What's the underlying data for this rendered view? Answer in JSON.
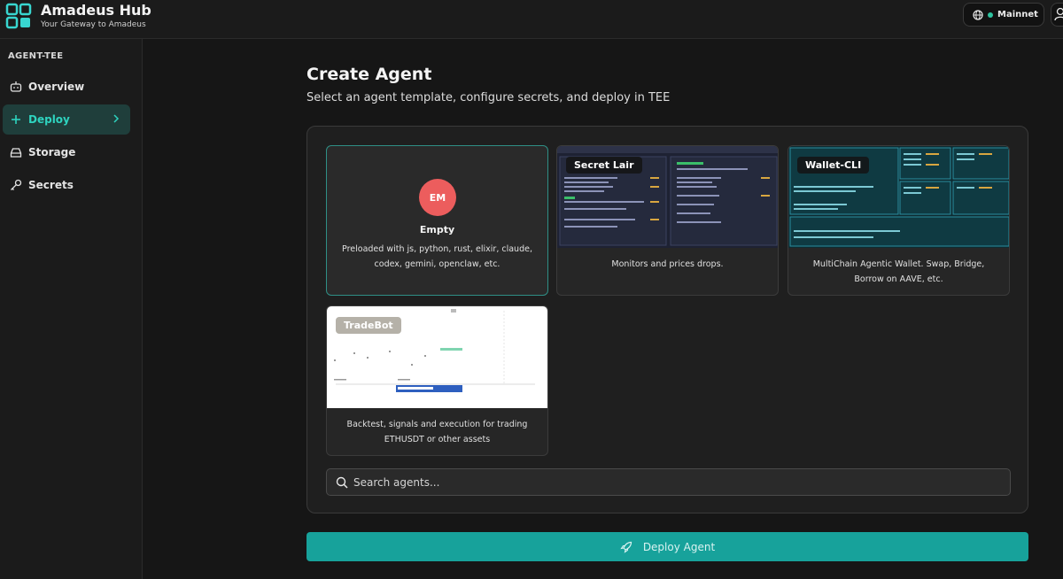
{
  "brand": {
    "title": "Amadeus Hub",
    "subtitle": "Your Gateway to Amadeus"
  },
  "header": {
    "network_label": "Mainnet",
    "network_status_color": "#2ec4a0"
  },
  "sidebar": {
    "section": "AGENT-TEE",
    "items": [
      {
        "label": "Overview",
        "icon": "robot-icon"
      },
      {
        "label": "Deploy",
        "icon": "plus-icon",
        "active": true
      },
      {
        "label": "Storage",
        "icon": "hard-drive-icon"
      },
      {
        "label": "Secrets",
        "icon": "key-icon"
      }
    ]
  },
  "main": {
    "title": "Create Agent",
    "subtitle": "Select an agent template, configure secrets, and deploy in TEE",
    "templates": [
      {
        "name": "Empty",
        "badge": "EM",
        "description_line1": "Preloaded with js, python, rust, elixir, claude,",
        "description_line2": "codex, gemini, openclaw, etc.",
        "selected": true
      },
      {
        "name": "Secret Lair",
        "description_line1": "Monitors and prices drops."
      },
      {
        "name": "Wallet-CLI",
        "description_line1": "MultiChain Agentic Wallet. Swap, Bridge,",
        "description_line2": "Borrow on AAVE, etc."
      },
      {
        "name": "TradeBot",
        "description_line1": "Backtest, signals and execution for trading",
        "description_line2": "ETHUSDT or other assets"
      }
    ],
    "search_placeholder": "Search agents...",
    "deploy_label": "Deploy Agent"
  },
  "colors": {
    "accent": "#17a29b",
    "active_bg": "#1f3e3b",
    "active_text": "#2ed3bf",
    "badge": "#ec5d5d"
  }
}
